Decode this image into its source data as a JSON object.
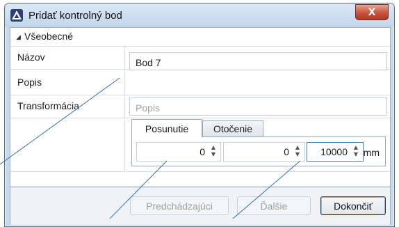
{
  "window": {
    "title": "Pridať kontrolný bod",
    "close_glyph": "X",
    "app_icon": "app-logo-icon"
  },
  "section": {
    "collapse_glyph": "◢",
    "title": "Všeobecné"
  },
  "properties": {
    "name_label": "Názov",
    "name_value": "Bod 7",
    "description_label": "Popis",
    "description_placeholder": "Popis",
    "transform_label": "Transformácia"
  },
  "tabs": [
    {
      "label": "Posunutie",
      "active": true
    },
    {
      "label": "Otočenie",
      "active": false
    }
  ],
  "spinners": [
    {
      "value": "0"
    },
    {
      "value": "0"
    },
    {
      "value": "10000"
    }
  ],
  "spin_up_glyph": "▲",
  "spin_down_glyph": "▼",
  "unit": "mm",
  "buttons": {
    "previous": "Predchádzajúci",
    "next": "Ďalšie",
    "finish": "Dokončiť"
  },
  "colors": {
    "accent": "#3c7fb1",
    "annotation_line": "#2f6fb5",
    "close_button": "#c9523b"
  }
}
